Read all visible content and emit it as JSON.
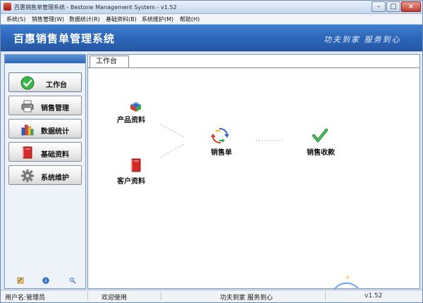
{
  "window": {
    "title": "百惠销售单管理系统 - Bestone Management System - v1.52",
    "controls": {
      "minimize": "–",
      "maximize": "□",
      "close": "×"
    }
  },
  "menu": {
    "items": [
      "系统(S)",
      "销售管理(W)",
      "数据统计(R)",
      "基础资料(B)",
      "系统维护(M)",
      "帮助(H)"
    ]
  },
  "header": {
    "title": "百惠销售单管理系统",
    "slogan": "功夫到家 服务到心"
  },
  "sidebar": {
    "items": [
      {
        "label": "工作台",
        "icon": "green-check-icon",
        "active": true
      },
      {
        "label": "销售管理",
        "icon": "printer-icon",
        "active": false
      },
      {
        "label": "数据统计",
        "icon": "bar-chart-icon",
        "active": false
      },
      {
        "label": "基础资料",
        "icon": "red-book-icon",
        "active": false
      },
      {
        "label": "系统维护",
        "icon": "gear-icon",
        "active": false
      }
    ],
    "bottom_icons": [
      "edit-icon",
      "info-icon",
      "search-icon"
    ]
  },
  "workspace": {
    "tab_label": "工作台",
    "nodes": {
      "product": {
        "label": "产品资料",
        "icon": "product-blocks-icon"
      },
      "customer": {
        "label": "客户资料",
        "icon": "red-book-icon"
      },
      "sales_order": {
        "label": "销售单",
        "icon": "sales-arrows-icon"
      },
      "sales_receipt": {
        "label": "销售收款",
        "icon": "green-check-icon"
      }
    }
  },
  "status": {
    "user": "用户名:管理员",
    "welcome": "欢迎使用",
    "slogan": "功夫到家 服务到心",
    "version": "v1.52"
  },
  "colors": {
    "header_blue": "#2b64b6",
    "menu_bg": "#f1f5fa",
    "accent_green": "#2ea84a",
    "red": "#d72828"
  }
}
